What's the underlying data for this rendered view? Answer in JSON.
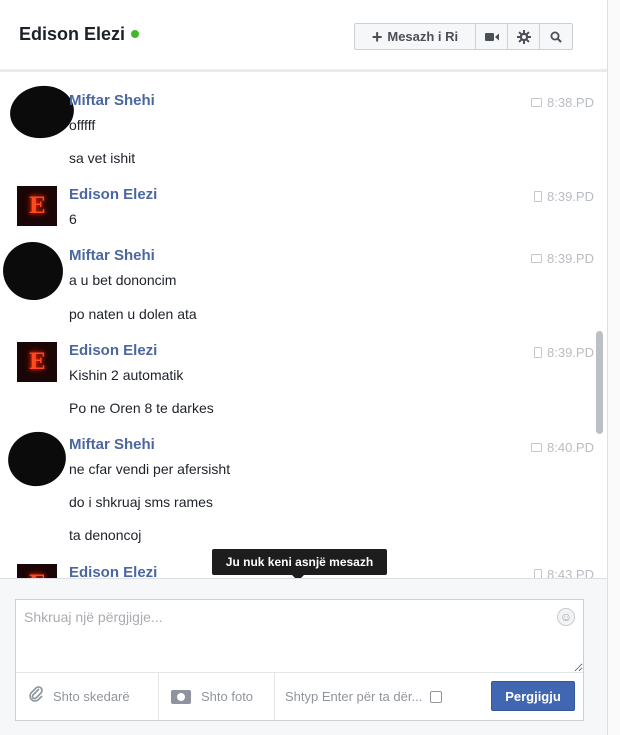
{
  "header": {
    "title": "Edison Elezi",
    "new_message_label": "Mesazh i Ri"
  },
  "messages": [
    {
      "sender": "Miftar Shehi",
      "time": "8:38.PD",
      "lines": [
        "offfff",
        "sa vet ishit"
      ]
    },
    {
      "sender": "Edison Elezi",
      "time": "8:39.PD",
      "lines": [
        "6"
      ]
    },
    {
      "sender": "Miftar Shehi",
      "time": "8:39.PD",
      "lines": [
        "a u bet dononcim",
        "po naten u dolen ata"
      ]
    },
    {
      "sender": "Edison Elezi",
      "time": "8:39.PD",
      "lines": [
        "Kishin 2 automatik",
        "Po ne Oren 8 te darkes"
      ]
    },
    {
      "sender": "Miftar Shehi",
      "time": "8:40.PD",
      "lines": [
        "ne cfar vendi per afersisht",
        "do i shkruaj sms rames",
        "ta denoncoj"
      ]
    },
    {
      "sender": "Edison Elezi",
      "time": "8:43.PD",
      "lines": []
    }
  ],
  "tooltip": "Ju nuk keni asnjë mesazh",
  "composer": {
    "placeholder": "Shkruaj një përgjigje...",
    "attach_label": "Shto skedarë",
    "photo_label": "Shto foto",
    "enter_label": "Shtyp Enter për ta dër...",
    "send_label": "Pergjigju"
  },
  "icons": {
    "online": "online-dot-icon",
    "video": "video-camera-icon",
    "settings": "gear-icon",
    "search": "search-icon",
    "attach": "paperclip-icon",
    "photo": "camera-icon",
    "emoji": "smiley-icon"
  },
  "colors": {
    "accent": "#4267b2",
    "name": "#4b67a1",
    "online": "#42b72a"
  }
}
